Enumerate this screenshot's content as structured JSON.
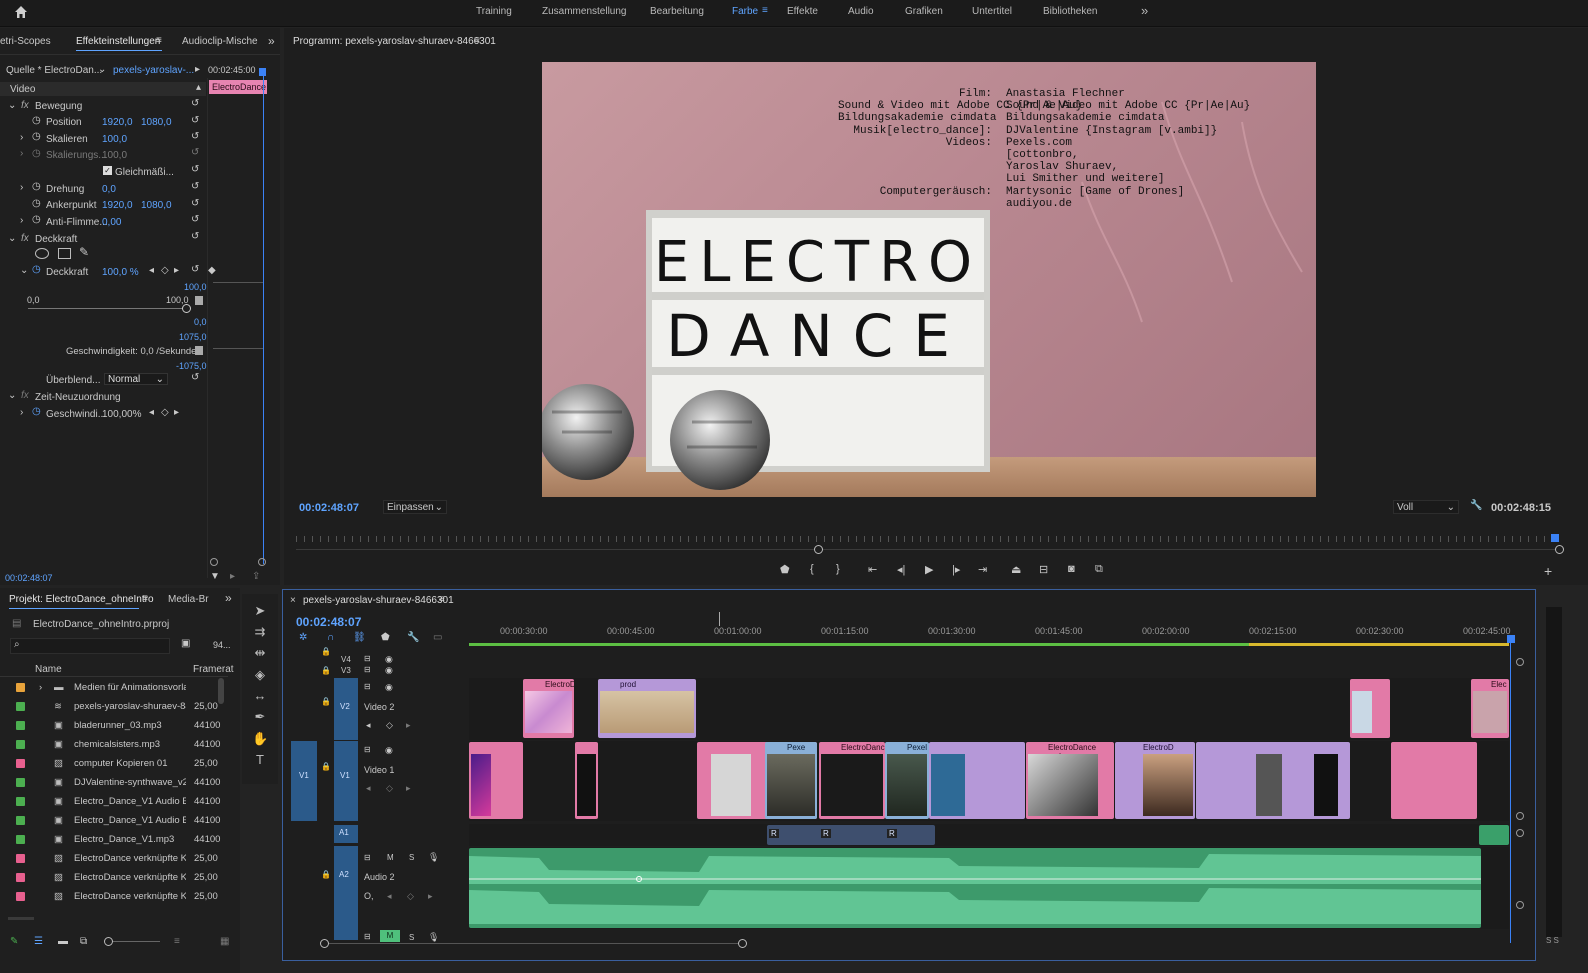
{
  "topbar": {
    "home_icon": "home-icon",
    "workspaces": [
      "Training",
      "Zusammenstellung",
      "Bearbeitung",
      "Farbe",
      "Effekte",
      "Audio",
      "Grafiken",
      "Untertitel",
      "Bibliotheken"
    ],
    "active": "Farbe",
    "overflow": "»"
  },
  "effects_panel": {
    "tabs": [
      "etri-Scopes",
      "Effekteinstellungen",
      "Audioclip-Mische"
    ],
    "source_label": "Quelle * ElectroDan...",
    "source_link": "pexels-yaroslav-...",
    "time_header": "00:02:45:00",
    "clip_chip": "ElectroDance",
    "section_video": "Video",
    "bewegung": "Bewegung",
    "position_label": "Position",
    "position_x": "1920,0",
    "position_y": "1080,0",
    "skalieren_label": "Skalieren",
    "skalieren_val": "100,0",
    "skalierungs_label": "Skalierungs...",
    "skalierungs_val": "100,0",
    "gleichmassig": "Gleichmäßi...",
    "drehung_label": "Drehung",
    "drehung_val": "0,0",
    "anker_label": "Ankerpunkt",
    "anker_x": "1920,0",
    "anker_y": "1080,0",
    "antiflimmer_label": "Anti-Flimme...",
    "antiflimmer_val": "0,00",
    "deckkraft_section": "Deckkraft",
    "deckkraft_label": "Deckkraft",
    "deckkraft_val": "100,0 %",
    "graph_top": "100,0",
    "range_min": "0,0",
    "range_max": "100,0",
    "graph_zero": "0,0",
    "graph_hi": "1075,0",
    "speed_text": "Geschwindigkeit: 0,0 /Sekunde",
    "graph_lo": "-1075,0",
    "blend_label": "Überblend...",
    "blend_val": "Normal",
    "zeit_section": "Zeit-Neuzuordnung",
    "geschw_label": "Geschwindi...",
    "geschw_val": "100,00%",
    "bottom_time": "00:02:48:07"
  },
  "program_monitor": {
    "title": "Programm: pexels-yaroslav-shuraev-8466301",
    "credits_labels": "Film:\nSound & Video mit Adobe CC {Pr|Ae|Au}\nBildungsakademie cimdata\nMusik[electro_dance]:\nVideos:\n\n\n\nComputergeräusch:",
    "credits_values": "Anastasia Flechner\nSound & Video mit Adobe CC {Pr|Ae|Au}\nBildungsakademie cimdata\nDJValentine {Instagram [v.ambi]}\nPexels.com\n[cottonbro,\nYaroslav Shuraev,\nLui Smither und weitere]\nMartysonic [Game of Drones]\naudiyou.de",
    "lightbox_line1": "ELECTRO",
    "lightbox_line2": "DANCE",
    "timecode": "00:02:48:07",
    "fit": "Einpassen",
    "quality": "Voll",
    "duration": "00:02:48:15"
  },
  "project_panel": {
    "tabs": [
      "Projekt: ElectroDance_ohneIntro",
      "Media-Br"
    ],
    "file": "ElectroDance_ohneIntro.prproj",
    "count": "94...",
    "col_name": "Name",
    "col_rate": "Framerat",
    "items": [
      {
        "name": "Medien für Animationsvorla",
        "rate": "",
        "color": "#e8a33b",
        "icon": "folder-icon"
      },
      {
        "name": "pexels-yaroslav-shuraev-846",
        "rate": "25,00",
        "color": "#4caf50",
        "icon": "sequence-icon"
      },
      {
        "name": "bladerunner_03.mp3",
        "rate": "44100",
        "color": "#4caf50",
        "icon": "audio-icon"
      },
      {
        "name": "chemicalsisters.mp3",
        "rate": "44100",
        "color": "#4caf50",
        "icon": "audio-icon"
      },
      {
        "name": "computer Kopieren 01",
        "rate": "25,00",
        "color": "#e8608f",
        "icon": "video-icon"
      },
      {
        "name": "DJValentine-synthwave_v2.",
        "rate": "44100",
        "color": "#4caf50",
        "icon": "audio-icon"
      },
      {
        "name": "Electro_Dance_V1 Audio Ex",
        "rate": "44100",
        "color": "#4caf50",
        "icon": "audio-icon"
      },
      {
        "name": "Electro_Dance_V1 Audio Ex",
        "rate": "44100",
        "color": "#4caf50",
        "icon": "audio-icon"
      },
      {
        "name": "Electro_Dance_V1.mp3",
        "rate": "44100",
        "color": "#4caf50",
        "icon": "audio-icon"
      },
      {
        "name": "ElectroDance verknüpfte Ko",
        "rate": "25,00",
        "color": "#e8608f",
        "icon": "video-icon"
      },
      {
        "name": "ElectroDance verknüpfte Ko",
        "rate": "25,00",
        "color": "#e8608f",
        "icon": "video-icon"
      },
      {
        "name": "ElectroDance verknüpfte Ko",
        "rate": "25,00",
        "color": "#e8608f",
        "icon": "video-icon"
      }
    ]
  },
  "timeline": {
    "tab": "pexels-yaroslav-shuraev-8466301",
    "timecode": "00:02:48:07",
    "ruler": [
      "00:00:30:00",
      "00:00:45:00",
      "00:01:00:00",
      "00:01:15:00",
      "00:01:30:00",
      "00:01:45:00",
      "00:02:00:00",
      "00:02:15:00",
      "00:02:30:00",
      "00:02:45:00"
    ],
    "tracks": {
      "v4": "V4",
      "v3": "V3",
      "v2": "V2",
      "v2_name": "Video 2",
      "v1": "V1",
      "v1_src": "V1",
      "v1_name": "Video 1",
      "a1": "A1",
      "a2": "A2",
      "a2_name": "Audio 2",
      "m": "M",
      "s": "S"
    },
    "clips": {
      "v2_a": "ElectroD",
      "v2_b": "prod",
      "v2_c": "Elec",
      "v1_a": "Pexe",
      "v1_b": "ElectroDance",
      "v1_c": "Pexel",
      "v1_d": "ElectroDance verkn",
      "v1_e": "ElectroD",
      "a1_r": "R"
    },
    "audio_meter": "S S"
  }
}
